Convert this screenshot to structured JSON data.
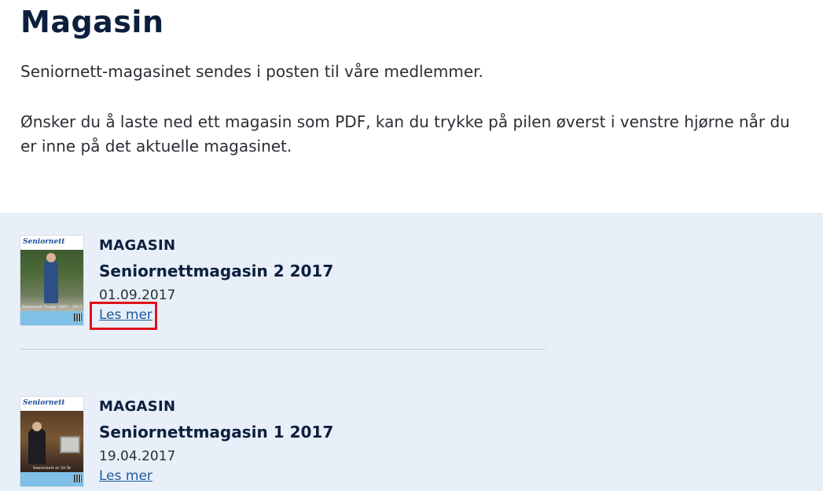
{
  "page": {
    "title": "Magasin",
    "intro_p1": "Seniornett-magasinet sendes i posten til våre medlemmer.",
    "intro_p2": "Ønsker du å laste ned ett magasin som PDF, kan du trykke på pilen øverst i venstre hjørne når du er inne på det aktuelle magasinet."
  },
  "items": [
    {
      "category": "MAGASIN",
      "title": "Seniornettmagasin 2 2017",
      "date": "01.09.2017",
      "link_label": "Les mer",
      "thumbnail_logo": "Seniornett",
      "thumbnail_caption": "Seniornett Norge 2007 – 2017"
    },
    {
      "category": "MAGASIN",
      "title": "Seniornettmagasin 1 2017",
      "date": "19.04.2017",
      "link_label": "Les mer",
      "thumbnail_logo": "Seniornett",
      "thumbnail_caption": "Seniornett er 20 år"
    }
  ],
  "colors": {
    "heading": "#0c1f3d",
    "link": "#1e5a9e",
    "panel_bg": "#e8eff8",
    "highlight": "#e0111b"
  }
}
